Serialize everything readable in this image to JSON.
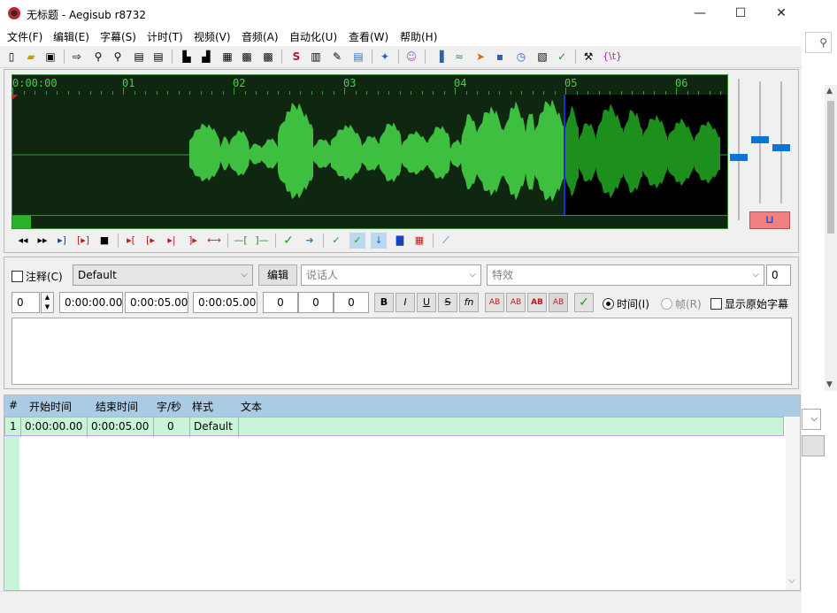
{
  "window": {
    "title": "无标题 - Aegisub r8732",
    "minimize_glyph": "—",
    "maximize_glyph": "☐",
    "close_glyph": "✕"
  },
  "menu": [
    "文件(F)",
    "编辑(E)",
    "字幕(S)",
    "计时(T)",
    "视频(V)",
    "音频(A)",
    "自动化(U)",
    "查看(W)",
    "帮助(H)"
  ],
  "toolbar": {
    "icons": [
      "new-file-icon",
      "open-file-icon",
      "save-icon",
      "jump-icon",
      "zoom-in-icon",
      "zoom-out-icon",
      "video-icon",
      "video-detach-icon",
      "timing-icon",
      "timing-end-icon",
      "keyframe-icon",
      "film-icon",
      "film-strip-icon",
      "styles-icon",
      "properties-icon",
      "attachments-icon",
      "fonts-icon",
      "automation-icon",
      "kanji-icon",
      "shift-times-icon",
      "sort-icon",
      "resample-icon",
      "loop-icon",
      "clock-icon",
      "translate-icon",
      "spellcheck-icon",
      "options-icon",
      "tags-icon"
    ],
    "tags_label": "{\\t}"
  },
  "audio": {
    "timeline_labels": [
      "0:00:00",
      "01",
      "02",
      "03",
      "04",
      "05",
      "06"
    ],
    "karaoke_label": "⊔",
    "progress_fraction": 0.026
  },
  "editor": {
    "comment_label": "注释(C)",
    "style_value": "Default",
    "edit_button": "编辑",
    "actor_placeholder": "说话人",
    "effect_placeholder": "特效",
    "effect_count": "0",
    "layer_value": "0",
    "start_time": "0:00:00.00",
    "end_time": "0:00:05.00",
    "duration": "0:00:05.00",
    "margin_l": "0",
    "margin_r": "0",
    "margin_v": "0",
    "bold": "B",
    "italic": "I",
    "underline": "U",
    "strike": "S",
    "fn": "fn",
    "ab": "AB",
    "time_radio": "时间(I)",
    "frame_radio": "帧(R)",
    "show_original": "显示原始字幕"
  },
  "grid": {
    "headers": [
      "#",
      "开始时间",
      "结束时间",
      "字/秒",
      "样式",
      "文本"
    ],
    "row": {
      "num": "1",
      "start": "0:00:00.00",
      "end": "0:00:05.00",
      "cps": "0",
      "style": "Default",
      "text": ""
    }
  }
}
